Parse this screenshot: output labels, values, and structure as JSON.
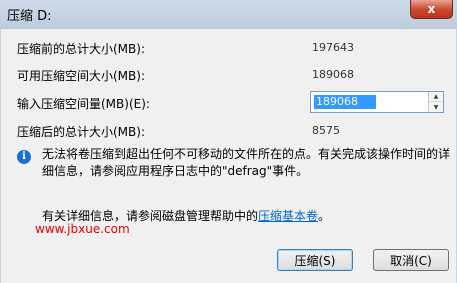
{
  "window": {
    "title": "压缩 D:",
    "close_label": "x"
  },
  "fields": [
    {
      "label": "压缩前的总计大小(MB):",
      "value": "197643"
    },
    {
      "label": "可用压缩空间大小(MB):",
      "value": "189068"
    },
    {
      "label": "输入压缩空间量(MB)(E):",
      "value": "189068"
    },
    {
      "label": "压缩后的总计大小(MB):",
      "value": "8575"
    }
  ],
  "info": {
    "icon": "info-icon",
    "text": "无法将卷压缩到超出任何不可移动的文件所在的点。有关完成该操作时间的详细信息，请参阅应用程序日志中的\"defrag\"事件。"
  },
  "help": {
    "prefix": "有关详细信息，请参阅磁盘管理帮助中的",
    "link": "压缩基本卷",
    "suffix": "。"
  },
  "watermark": {
    "text": "脚 本 之 家",
    "url": "www.jbxue.com"
  },
  "buttons": {
    "shrink": "压缩(S)",
    "cancel": "取消(C)"
  },
  "colors": {
    "selection": "#3399ff",
    "link": "#0066cc",
    "watermark": "#e20000"
  }
}
